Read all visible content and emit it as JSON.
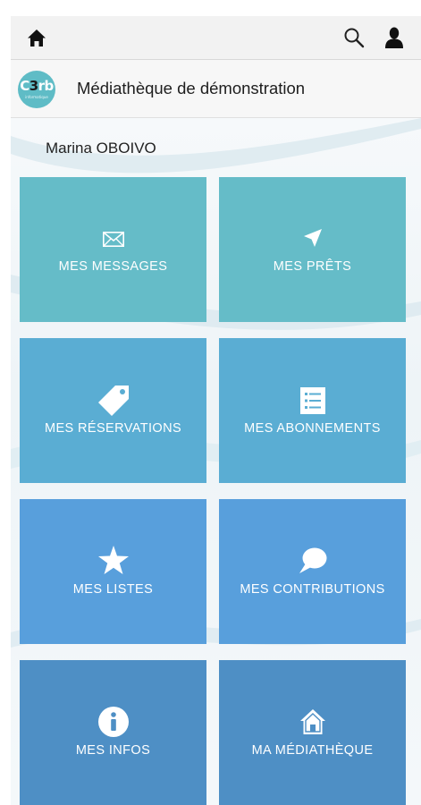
{
  "site": {
    "title": "Médiathèque de démonstration",
    "logo": {
      "main_left": "C",
      "main_mid": "3",
      "main_right": "rb",
      "sub": "informatique"
    }
  },
  "user": {
    "name": "Marina OBOIVO"
  },
  "topbar": {
    "icons": [
      "home-icon",
      "search-icon",
      "user-icon"
    ]
  },
  "tiles": [
    {
      "label": "MES MESSAGES",
      "icon": "envelope-icon",
      "color": "#65bcc8"
    },
    {
      "label": "MES PRÊTS",
      "icon": "paper-plane-icon",
      "color": "#65bcc8"
    },
    {
      "label": "MES RÉSERVATIONS",
      "icon": "tag-icon",
      "color": "#5aadd3"
    },
    {
      "label": "MES ABONNEMENTS",
      "icon": "list-icon",
      "color": "#5aadd3"
    },
    {
      "label": "MES LISTES",
      "icon": "star-icon",
      "color": "#589fdc"
    },
    {
      "label": "MES CONTRIBUTIONS",
      "icon": "speech-bubble-icon",
      "color": "#589fdc"
    },
    {
      "label": "MES INFOS",
      "icon": "info-icon",
      "color": "#4e8fc5"
    },
    {
      "label": "MA MÉDIATHÈQUE",
      "icon": "house-icon",
      "color": "#4e8fc5"
    }
  ]
}
